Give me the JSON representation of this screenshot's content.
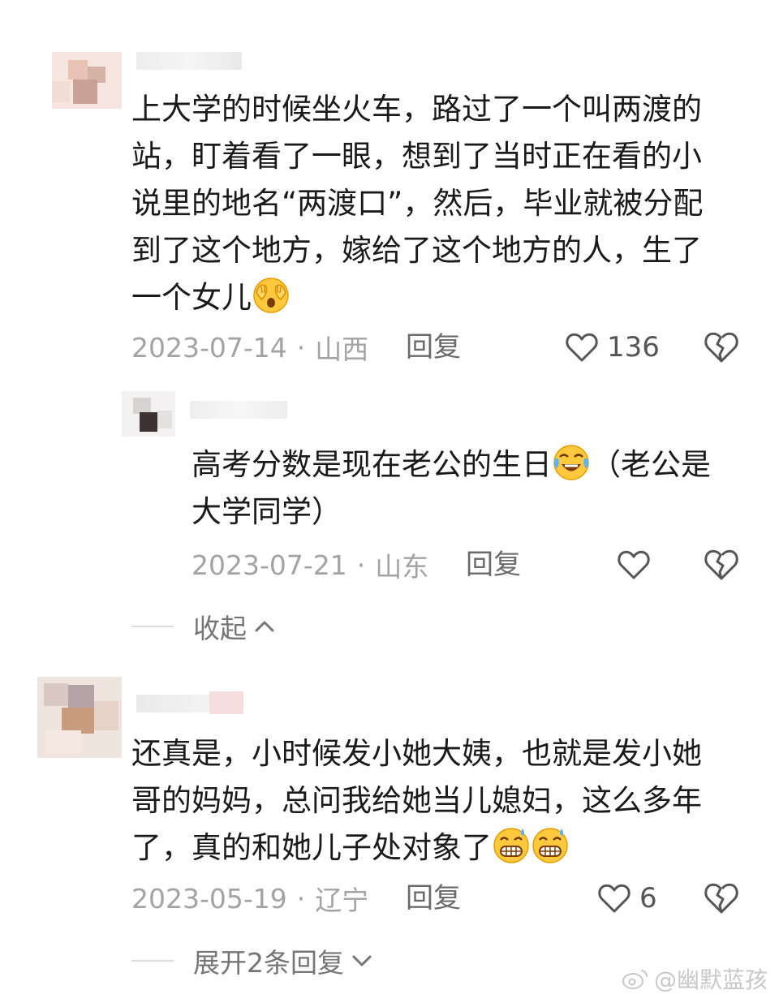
{
  "comments": [
    {
      "text_before_emoji": "上大学的时候坐火车，路过了一个叫两渡的站，盯着看了一眼，想到了当时正在看的小说里的地名“两渡口”，然后，毕业就被分配到了这个地方，嫁给了这个地方的人，生了一个女儿",
      "emoji": "face-covering-eyes-emoji",
      "date": "2023-07-14",
      "location": "山西",
      "reply_label": "回复",
      "likes": "136"
    },
    {
      "text_before_emoji": "还真是，小时候发小她大姨，也就是发小她哥的妈妈，总问我给她当儿媳妇，这么多年了，真的和她儿子处对象了",
      "emoji": "grinning-sweat-emoji",
      "date": "2023-05-19",
      "location": "辽宁",
      "reply_label": "回复",
      "likes": "6"
    }
  ],
  "reply": {
    "text_before_emoji": "高考分数是现在老公的生日",
    "text_after_emoji": "（老公是大学同学）",
    "emoji": "laughing-tears-emoji",
    "date": "2023-07-21",
    "location": "山东",
    "reply_label": "回复"
  },
  "collapse_label": "收起",
  "expand_label": "展开2条回复",
  "separator": "·",
  "watermark": "@幽默蓝孩",
  "colors": {
    "text": "#1a1a1a",
    "meta": "#a3a3a3",
    "emoji_yellow": "#ffc83d"
  }
}
